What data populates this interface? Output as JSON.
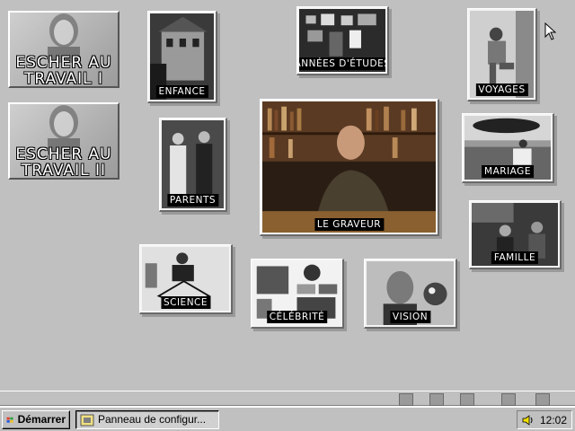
{
  "desktop": {
    "big_buttons": [
      {
        "line1": "ESCHER AU",
        "line2": "TRAVAIL I"
      },
      {
        "line1": "ESCHER AU",
        "line2": "TRAVAIL II"
      }
    ],
    "tiles": {
      "enfance": "ENFANCE",
      "etudes": "ANNÉES D'ÉTUDES",
      "voyages": "VOYAGES",
      "parents": "PARENTS",
      "graveur": "LE GRAVEUR",
      "mariage": "MARIAGE",
      "famille": "FAMILLE",
      "science": "SCIENCE",
      "celebrite": "CÉLÉBRITÉ",
      "vision": "VISION"
    }
  },
  "taskbar": {
    "start_label": "Démarrer",
    "task_label": "Panneau de configur...",
    "clock": "12:02"
  },
  "icons": {
    "start": "windows-logo-icon",
    "task": "control-panel-icon",
    "volume": "speaker-icon",
    "cursor": "mouse-pointer-icon"
  }
}
